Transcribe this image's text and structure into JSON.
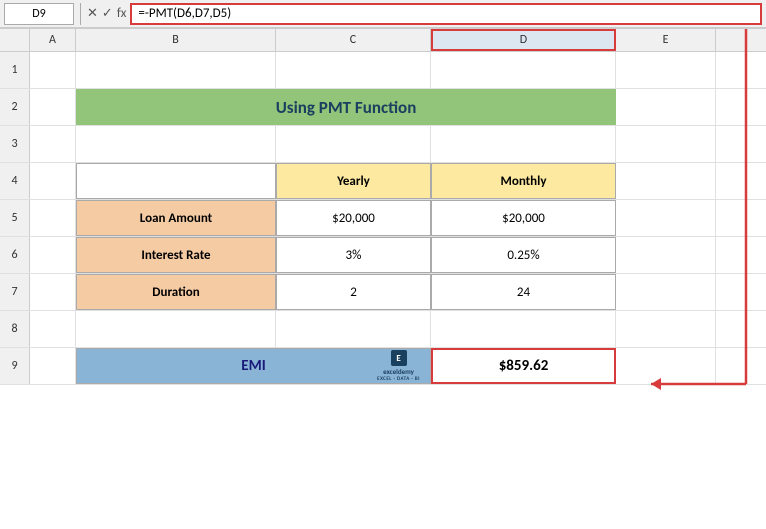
{
  "formula_bar": {
    "cell_ref": "D9",
    "formula": "=-PMT(D6,D7,D5)"
  },
  "columns": {
    "headers": [
      "A",
      "B",
      "C",
      "D",
      "E"
    ]
  },
  "rows": {
    "numbers": [
      1,
      2,
      3,
      4,
      5,
      6,
      7,
      8,
      9
    ]
  },
  "title": {
    "text": "Using PMT Function"
  },
  "table": {
    "col_yearly": "Yearly",
    "col_monthly": "Monthly",
    "row_labels": [
      "Loan Amount",
      "Interest Rate",
      "Duration"
    ],
    "yearly_values": [
      "$20,000",
      "3%",
      "2"
    ],
    "monthly_values": [
      "$20,000",
      "0.25%",
      "24"
    ]
  },
  "emi": {
    "label": "EMI",
    "value": "$859.62",
    "logo_text": "exceldemy",
    "logo_sub": "EXCEL · DATA · BI"
  },
  "icons": {
    "x_mark": "✕",
    "check_mark": "✓",
    "fx": "fx"
  }
}
